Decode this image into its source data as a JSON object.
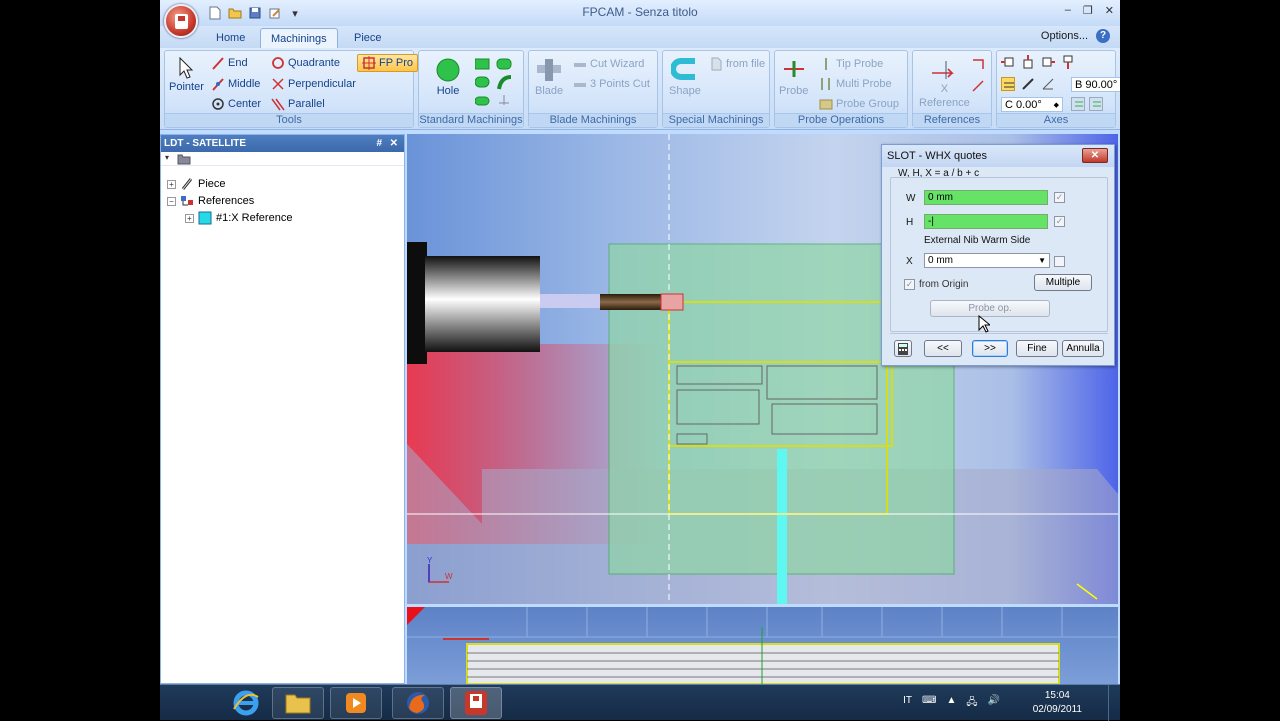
{
  "window": {
    "title": "FPCAM - Senza titolo"
  },
  "ribbon": {
    "tabs": [
      "Home",
      "Machinings",
      "Piece"
    ],
    "active_tab": "Machinings",
    "options_label": "Options...",
    "help_label": "?",
    "tools": {
      "caption": "Tools",
      "pointer": "Pointer",
      "end": "End",
      "middle": "Middle",
      "center": "Center",
      "quadrante": "Quadrante",
      "perpendicular": "Perpendicular",
      "parallel": "Parallel",
      "fp_pro": "FP Pro"
    },
    "standard": {
      "caption": "Standard Machinings",
      "hole": "Hole"
    },
    "blade": {
      "caption": "Blade Machinings",
      "blade": "Blade",
      "cut_wizard": "Cut Wizard",
      "three_points": "3 Points Cut"
    },
    "special": {
      "caption": "Special Machinings",
      "shape": "Shape",
      "from_file": "from file"
    },
    "probe": {
      "caption": "Probe Operations",
      "probe": "Probe",
      "tip_probe": "Tip Probe",
      "multi_probe": "Multi Probe",
      "probe_group": "Probe Group"
    },
    "references": {
      "caption": "References",
      "x_reference_line1": "X",
      "x_reference_line2": "Reference"
    },
    "axes": {
      "caption": "Axes",
      "b_value": "B 90.00°",
      "c_value": "C 0.00°"
    }
  },
  "left_panel": {
    "title": "LDT - SATELLITE",
    "pin": "#",
    "close": "✕",
    "tree": [
      {
        "label": "Piece",
        "expander": "+"
      },
      {
        "label": "References",
        "expander": "−"
      },
      {
        "label": "#1:X Reference",
        "expander": "+"
      }
    ]
  },
  "dialog": {
    "title": "SLOT - WHX quotes",
    "close": "✕",
    "formula": "W, H, X = a / b + c",
    "w_label": "W",
    "w_value": "0 mm",
    "h_label": "H",
    "h_value": "-|",
    "side_text": "External Nib Warm Side",
    "x_label": "X",
    "x_value": "0 mm",
    "from_origin": "from Origin",
    "multiple": "Multiple",
    "probe_op": "Probe op.",
    "prev": "<<",
    "next": ">>",
    "fine": "Fine",
    "annulla": "Annulla"
  },
  "viewport": {
    "axis_x": "W",
    "axis_y": "Y"
  },
  "taskbar": {
    "lang": "IT",
    "time": "15:04",
    "date": "02/09/2011"
  }
}
